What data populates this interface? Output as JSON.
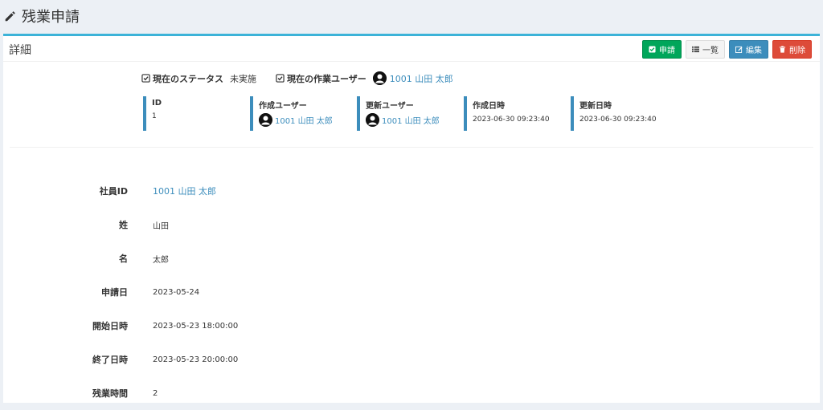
{
  "page": {
    "title": "残業申請"
  },
  "box": {
    "title": "詳細",
    "buttons": {
      "apply": "申請",
      "list": "一覧",
      "edit": "編集",
      "delete": "削除"
    }
  },
  "status": {
    "status_label": "現在のステータス",
    "status_value": "未実施",
    "worker_label": "現在の作業ユーザー",
    "worker_value": "1001 山田 太郎"
  },
  "meta": {
    "id_label": "ID",
    "id_value": "1",
    "created_by_label": "作成ユーザー",
    "created_by_value": "1001 山田 太郎",
    "updated_by_label": "更新ユーザー",
    "updated_by_value": "1001 山田 太郎",
    "created_at_label": "作成日時",
    "created_at_value": "2023-06-30 09:23:40",
    "updated_at_label": "更新日時",
    "updated_at_value": "2023-06-30 09:23:40"
  },
  "details": [
    {
      "label": "社員ID",
      "value": "1001 山田 太郎"
    },
    {
      "label": "姓",
      "value": "山田"
    },
    {
      "label": "名",
      "value": "太郎"
    },
    {
      "label": "申請日",
      "value": "2023-05-24"
    },
    {
      "label": "開始日時",
      "value": "2023-05-23 18:00:00"
    },
    {
      "label": "終了日時",
      "value": "2023-05-23 20:00:00"
    },
    {
      "label": "残業時間",
      "value": "2"
    }
  ],
  "colors": {
    "accent": "#3cb3d8",
    "link": "#3c8dbc",
    "success": "#00a65a",
    "danger": "#dd4b39"
  }
}
